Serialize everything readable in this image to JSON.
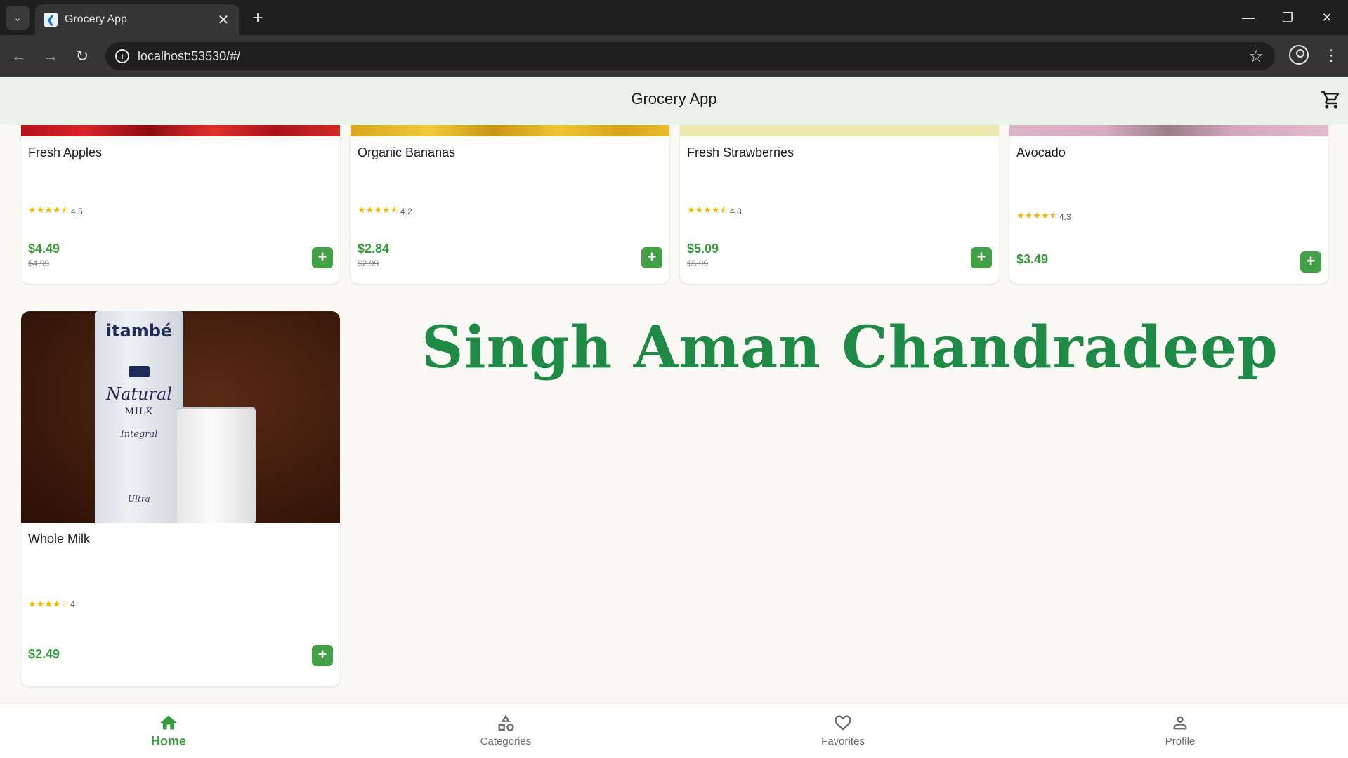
{
  "browser": {
    "tab_title": "Grocery App",
    "url": "localhost:53530/#/",
    "tab_menu_icon": "chevron-down-icon",
    "close_icon": "close-icon",
    "new_tab_icon": "plus-icon"
  },
  "app": {
    "title": "Grocery App",
    "accent_color": "#3a9b3e",
    "button_color": "#43a047",
    "appbar_color": "#e8f2e8"
  },
  "products": [
    {
      "name": "Fresh Apples",
      "rating": "4.5",
      "price": "$4.49",
      "old_price": "$4.99",
      "stars": "★★★★⯪"
    },
    {
      "name": "Organic Bananas",
      "rating": "4.2",
      "price": "$2.84",
      "old_price": "$2.99",
      "stars": "★★★★⯪"
    },
    {
      "name": "Fresh Strawberries",
      "rating": "4.8",
      "price": "$5.09",
      "old_price": "$5.99",
      "stars": "★★★★⯪"
    },
    {
      "name": "Avocado",
      "rating": "4.3",
      "price": "$3.49",
      "old_price": "",
      "stars": "★★★★⯪"
    },
    {
      "name": "Whole Milk",
      "rating": "4",
      "price": "$2.49",
      "old_price": "",
      "stars": "★★★★☆"
    }
  ],
  "milk_image": {
    "brand": "itambé",
    "product": "Natural",
    "type": "MILK",
    "variant": "Integral",
    "sub": "Ultra"
  },
  "watermark": "Singh Aman Chandradeep",
  "bottom_nav": [
    {
      "label": "Home",
      "icon": "home-icon",
      "active": true
    },
    {
      "label": "Categories",
      "icon": "categories-icon",
      "active": false
    },
    {
      "label": "Favorites",
      "icon": "heart-icon",
      "active": false
    },
    {
      "label": "Profile",
      "icon": "person-icon",
      "active": false
    }
  ]
}
